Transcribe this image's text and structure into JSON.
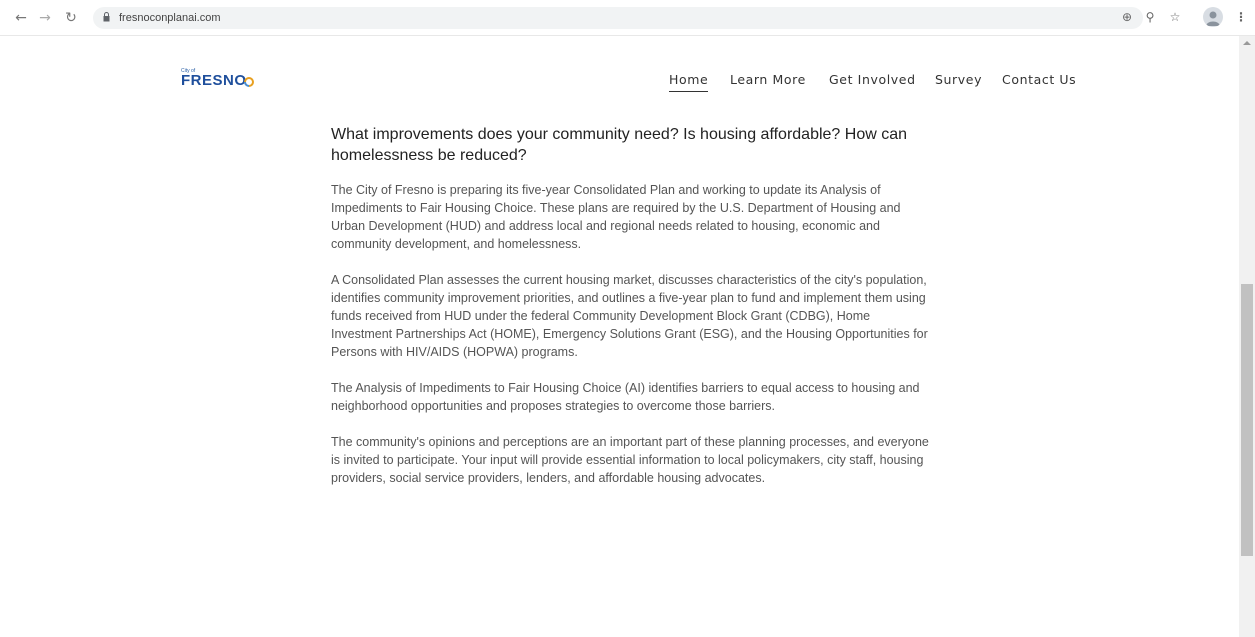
{
  "browser": {
    "url": "fresnoconplanai.com",
    "icons": [
      "back-icon",
      "forward-icon",
      "reload-icon",
      "lock-icon",
      "add-icon",
      "zoom-icon",
      "star-icon",
      "avatar-icon",
      "menu-icon"
    ]
  },
  "logo": {
    "small_text": "City of",
    "main_text": "FRESNO"
  },
  "nav": {
    "home": "Home",
    "learn_more": "Learn More",
    "get_involved": "Get Involved",
    "survey": "Survey",
    "contact_us": "Contact Us"
  },
  "content": {
    "headline": "What improvements does your community need? Is housing affordable? How can homelessness be reduced?",
    "paragraphs": [
      "The City of Fresno is preparing its five-year Consolidated Plan and working to update its Analysis of Impediments to Fair Housing Choice. These plans are required by the U.S. Department of Housing and Urban Development (HUD) and address local and regional needs related to housing, economic and community development, and homelessness.",
      "A Consolidated Plan assesses the current housing market, discusses characteristics of the city's population, identifies community improvement priorities, and outlines a five-year plan to fund and implement them using funds received from HUD under the federal Community Development Block Grant (CDBG), Home Investment Partnerships Act (HOME), Emergency Solutions Grant (ESG), and the Housing Opportunities for Persons with HIV/AIDS (HOPWA) programs.",
      "The Analysis of Impediments to Fair Housing Choice (AI) identifies barriers to equal access to housing and neighborhood opportunities and proposes strategies to overcome those barriers.",
      "The community's opinions and perceptions are an important part of these planning processes, and everyone is invited to participate. Your input will provide essential information to local policymakers, city staff, housing providers, social service providers, lenders, and affordable housing advocates."
    ]
  },
  "colors": {
    "brand_blue": "#1f4f9c",
    "nav_text": "#333333",
    "body_text": "#555555",
    "heading_text": "#222222"
  }
}
